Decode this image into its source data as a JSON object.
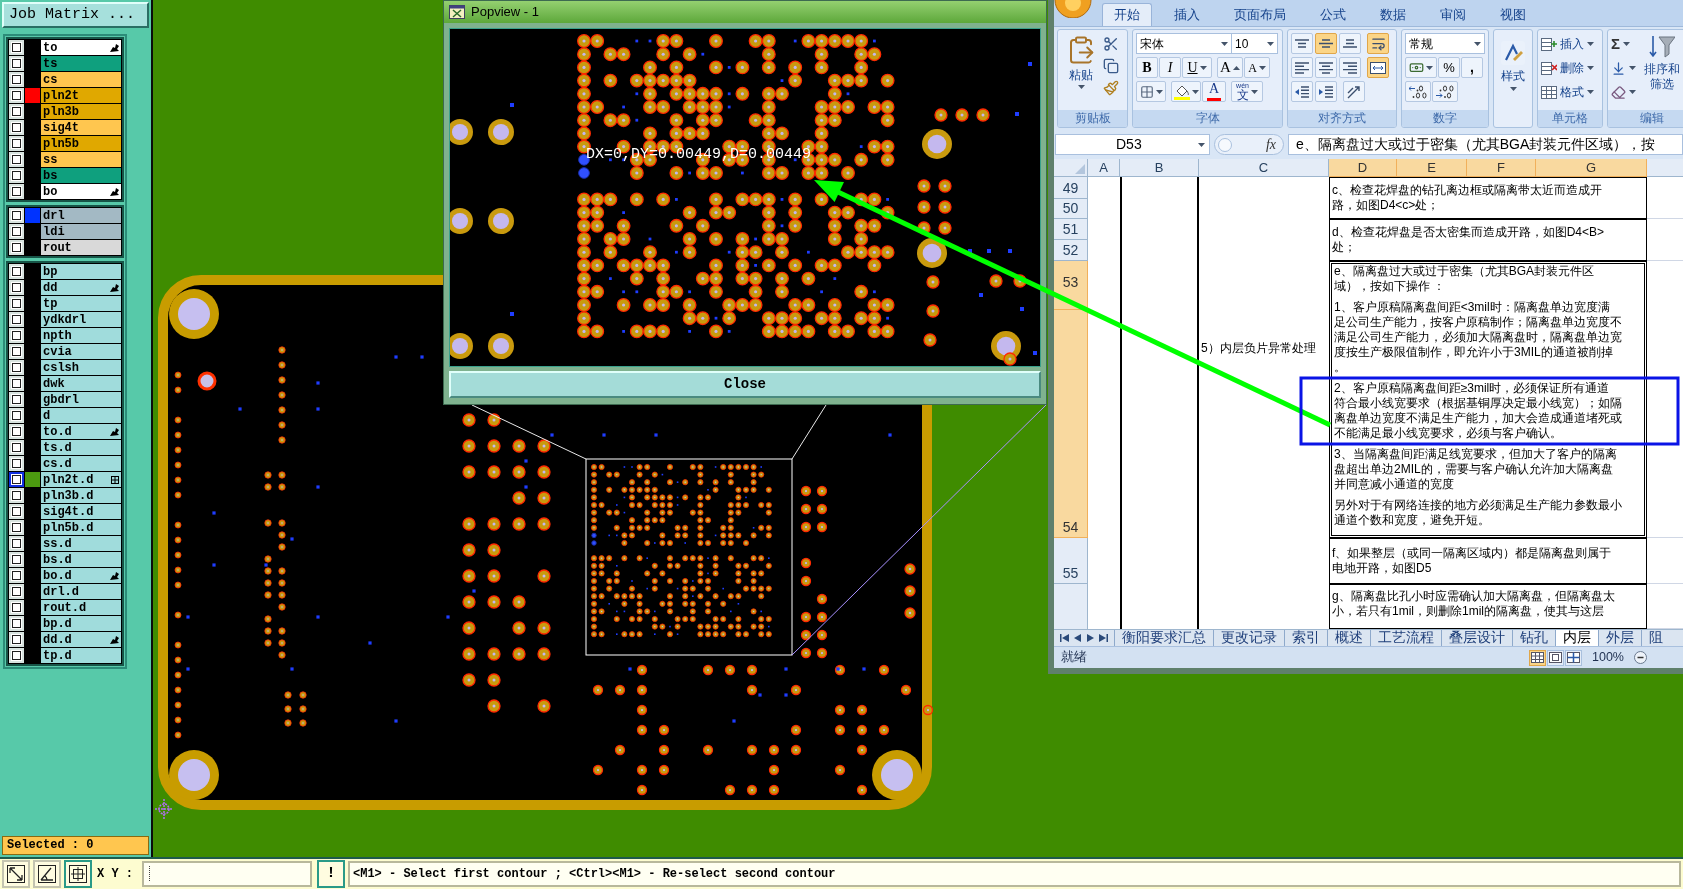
{
  "job_matrix": {
    "title": "Job Matrix ...",
    "groups": [
      {
        "layers": [
          {
            "name": "to",
            "color": "#ffffff",
            "kind": "hand",
            "checked": false,
            "selected": false
          },
          {
            "name": "ts",
            "color": "#0fa07e",
            "kind": "plain",
            "checked": false,
            "selected": false
          },
          {
            "name": "cs",
            "color": "#ffc64f",
            "kind": "plain",
            "checked": false,
            "selected": false
          },
          {
            "name": "pln2t",
            "color": "#e0a800",
            "kind": "plain",
            "checked": false,
            "selected": false,
            "swatch": {
              "color": "#ff0000"
            }
          },
          {
            "name": "pln3b",
            "color": "#e0a800",
            "kind": "plain",
            "checked": false,
            "selected": false
          },
          {
            "name": "sig4t",
            "color": "#ffc64f",
            "kind": "plain",
            "checked": false,
            "selected": false
          },
          {
            "name": "pln5b",
            "color": "#e0a800",
            "kind": "plain",
            "checked": false,
            "selected": false
          },
          {
            "name": "ss",
            "color": "#ffc64f",
            "kind": "plain",
            "checked": false,
            "selected": false
          },
          {
            "name": "bs",
            "color": "#0fa07e",
            "kind": "plain",
            "checked": false,
            "selected": false
          },
          {
            "name": "bo",
            "color": "#ffffff",
            "kind": "hand",
            "checked": false,
            "selected": false
          }
        ]
      },
      {
        "layers": [
          {
            "name": "drl",
            "color": "#a3b9c4",
            "kind": "plain",
            "checked": false,
            "selected": false,
            "swatch": {
              "color": "#0033ff"
            }
          },
          {
            "name": "ldi",
            "color": "#a3b9c4",
            "kind": "plain",
            "checked": false,
            "selected": false
          },
          {
            "name": "rout",
            "color": "#d9d9d9",
            "kind": "plain",
            "checked": false,
            "selected": false
          }
        ]
      },
      {
        "layers": [
          {
            "name": "bp",
            "color": "#a0dcdc",
            "kind": "plain",
            "checked": false,
            "selected": false
          },
          {
            "name": "dd",
            "color": "#a0dcdc",
            "kind": "hand",
            "checked": false,
            "selected": false
          },
          {
            "name": "tp",
            "color": "#a0dcdc",
            "kind": "plain",
            "checked": false,
            "selected": false
          },
          {
            "name": "ydkdrl",
            "color": "#a0dcdc",
            "kind": "plain",
            "checked": false,
            "selected": false
          },
          {
            "name": "npth",
            "color": "#a0dcdc",
            "kind": "plain",
            "checked": false,
            "selected": false
          },
          {
            "name": "cvia",
            "color": "#a0dcdc",
            "kind": "plain",
            "checked": false,
            "selected": false
          },
          {
            "name": "cslsh",
            "color": "#a0dcdc",
            "kind": "plain",
            "checked": false,
            "selected": false
          },
          {
            "name": "dwk",
            "color": "#a0dcdc",
            "kind": "plain",
            "checked": false,
            "selected": false
          },
          {
            "name": "gbdrl",
            "color": "#a0dcdc",
            "kind": "plain",
            "checked": false,
            "selected": false
          },
          {
            "name": "d",
            "color": "#a0dcdc",
            "kind": "plain",
            "checked": false,
            "selected": false
          },
          {
            "name": "to.d",
            "color": "#a0dcdc",
            "kind": "hand",
            "checked": false,
            "selected": false
          },
          {
            "name": "ts.d",
            "color": "#a0dcdc",
            "kind": "plain",
            "checked": false,
            "selected": false
          },
          {
            "name": "cs.d",
            "color": "#a0dcdc",
            "kind": "plain",
            "checked": false,
            "selected": false
          },
          {
            "name": "pln2t.d",
            "color": "#a0dcdc",
            "kind": "grid",
            "checked": false,
            "selected": true,
            "swatch": {
              "color": "#4c9a10"
            }
          },
          {
            "name": "pln3b.d",
            "color": "#a0dcdc",
            "kind": "plain",
            "checked": false,
            "selected": false
          },
          {
            "name": "sig4t.d",
            "color": "#a0dcdc",
            "kind": "plain",
            "checked": false,
            "selected": false
          },
          {
            "name": "pln5b.d",
            "color": "#a0dcdc",
            "kind": "plain",
            "checked": false,
            "selected": false
          },
          {
            "name": "ss.d",
            "color": "#a0dcdc",
            "kind": "plain",
            "checked": false,
            "selected": false
          },
          {
            "name": "bs.d",
            "color": "#a0dcdc",
            "kind": "plain",
            "checked": false,
            "selected": false
          },
          {
            "name": "bo.d",
            "color": "#a0dcdc",
            "kind": "hand",
            "checked": false,
            "selected": false
          },
          {
            "name": "drl.d",
            "color": "#a0dcdc",
            "kind": "plain",
            "checked": false,
            "selected": false
          },
          {
            "name": "rout.d",
            "color": "#a0dcdc",
            "kind": "plain",
            "checked": false,
            "selected": false
          },
          {
            "name": "bp.d",
            "color": "#a0dcdc",
            "kind": "plain",
            "checked": false,
            "selected": false
          },
          {
            "name": "dd.d",
            "color": "#a0dcdc",
            "kind": "hand",
            "checked": false,
            "selected": false
          },
          {
            "name": "tp.d",
            "color": "#a0dcdc",
            "kind": "plain",
            "checked": false,
            "selected": false
          }
        ]
      }
    ]
  },
  "selected_status": "Selected : 0",
  "popview": {
    "title": "Popview - 1",
    "measurement": "DX=0,DY=0.00449,D=0.00449",
    "close_button": "Close"
  },
  "excel": {
    "tabs": [
      {
        "label": "开始",
        "selected": true
      },
      {
        "label": "插入",
        "selected": false
      },
      {
        "label": "页面布局",
        "selected": false
      },
      {
        "label": "公式",
        "selected": false
      },
      {
        "label": "数据",
        "selected": false
      },
      {
        "label": "审阅",
        "selected": false
      },
      {
        "label": "视图",
        "selected": false
      }
    ],
    "ribbon": {
      "clipboard": {
        "label": "剪贴板",
        "paste": "粘贴"
      },
      "font": {
        "label": "字体",
        "font_name": "宋体",
        "font_size": "10",
        "bold": "B",
        "italic": "I",
        "underline": "U",
        "grow": "A",
        "shrink": "A",
        "font_color": "A",
        "phonetic": "文",
        "phonetic_reading": "wén"
      },
      "alignment": {
        "label": "对齐方式",
        "buttons": [
          {
            "kind": "top",
            "on": false
          },
          {
            "kind": "middle",
            "on": true
          },
          {
            "kind": "bottom",
            "on": false
          },
          {
            "kind": "wrap",
            "on": true
          },
          {
            "kind": "left",
            "on": false
          },
          {
            "kind": "center",
            "on": false
          },
          {
            "kind": "right",
            "on": false
          },
          {
            "kind": "merge",
            "on": true
          },
          {
            "kind": "indent_decrease",
            "on": false
          },
          {
            "kind": "indent_increase",
            "on": false
          },
          {
            "kind": "orientation",
            "on": false
          }
        ]
      },
      "number": {
        "label": "数字",
        "format": "常规",
        "percent": "%",
        "comma": ","
      },
      "styles": {
        "label": "样式"
      },
      "cells": {
        "label": "单元格",
        "items": [
          "插入",
          "删除",
          "格式"
        ]
      },
      "editing": {
        "label": "编辑",
        "sum": "Σ",
        "sort_filter": "排序和筛选"
      }
    },
    "name_box": "D53",
    "function_label": "fx",
    "formula": "e、隔离盘过大或过于密集（尤其BGA封装元件区域），按",
    "columns": [
      {
        "label": "A",
        "selected": false
      },
      {
        "label": "B",
        "selected": false
      },
      {
        "label": "C",
        "selected": false
      },
      {
        "label": "D",
        "selected": true
      },
      {
        "label": "E",
        "selected": true
      },
      {
        "label": "F",
        "selected": true
      },
      {
        "label": "G",
        "selected": true
      }
    ],
    "rows": [
      {
        "label": "49",
        "selected": false
      },
      {
        "label": "50",
        "selected": false
      },
      {
        "label": "51",
        "selected": false
      },
      {
        "label": "52",
        "selected": false
      },
      {
        "label": "53",
        "selected": true
      },
      {
        "label": "54",
        "selected": true
      },
      {
        "label": "55",
        "selected": false
      }
    ],
    "side_label": "5）内层负片异常处理",
    "cells": [
      {
        "paragraphs": [
          [
            "c、检查花焊盘的钻孔离边框或隔离带太近而造成开",
            "路，如图D4<c>处；"
          ]
        ],
        "selected": false
      },
      {
        "paragraphs": [
          [
            "d、检查花焊盘是否太密集而造成开路，如图D4<B>",
            "处；"
          ]
        ],
        "selected": false
      },
      {
        "paragraphs": [
          [
            "e、隔离盘过大或过于密集（尤其BGA封装元件区",
            "域），按如下操作 ："
          ],
          [
            "1、客户原稿隔离盘间距<3mil时：隔离盘单边宽度满",
            "足公司生产能力，按客户原稿制作；隔离盘单边宽度不",
            "满足公司生产能力，必须加大隔离盘时，隔离盘单边宽",
            "度按生产极限值制作，即允许小于3MIL的通道被削掉",
            "。"
          ],
          [
            "2、客户原稿隔离盘间距≥3mil时，必须保证所有通道",
            "符合最小线宽要求（根据基铜厚决定最小线宽）；如隔",
            "离盘单边宽度不满足生产能力，加大会造成通道堵死或",
            "不能满足最小线宽要求，必须与客户确认。"
          ],
          [
            "3、当隔离盘间距满足线宽要求，但加大了客户的隔离",
            "盘超出单边2MIL的，需要与客户确认允许加大隔离盘",
            "并同意减小通道的宽度"
          ],
          [
            "另外对于有网络连接的地方必须满足生产能力参数最小",
            "通道个数和宽度，避免开短。"
          ]
        ],
        "selected": true
      },
      {
        "paragraphs": [
          [
            "f、如果整层（或同一隔离区域内）都是隔离盘则属于",
            "电地开路，如图D5"
          ]
        ],
        "selected": false
      },
      {
        "paragraphs": [
          [
            "g、隔离盘比孔小时应需确认加大隔离盘，但隔离盘太",
            "小，若只有1mil，则删除1mil的隔离盘，使其与这层"
          ]
        ],
        "selected": false
      }
    ],
    "sheet_tabs": [
      {
        "label": "衡阳要求汇总",
        "selected": false
      },
      {
        "label": "更改记录",
        "selected": false
      },
      {
        "label": "索引",
        "selected": false
      },
      {
        "label": "概述",
        "selected": false
      },
      {
        "label": "工艺流程",
        "selected": false
      },
      {
        "label": "叠层设计",
        "selected": false
      },
      {
        "label": "钻孔",
        "selected": false
      },
      {
        "label": "内层",
        "selected": true
      },
      {
        "label": "外层",
        "selected": false
      },
      {
        "label": "阻",
        "selected": false
      }
    ],
    "status": "就绪",
    "views": [
      {
        "kind": "normal",
        "selected": true
      },
      {
        "kind": "page_layout",
        "selected": false
      },
      {
        "kind": "page_break",
        "selected": false
      }
    ],
    "zoom": "100%"
  },
  "bottom_bar": {
    "tools": [
      {
        "kind": "resize",
        "selected": false
      },
      {
        "kind": "angle",
        "selected": false
      },
      {
        "kind": "grid",
        "selected": true
      }
    ],
    "xy_label": "X Y :",
    "alert_button": "!",
    "message": "<M1> - Select first contour ; <Ctrl><M1> - Re-select second contour"
  }
}
